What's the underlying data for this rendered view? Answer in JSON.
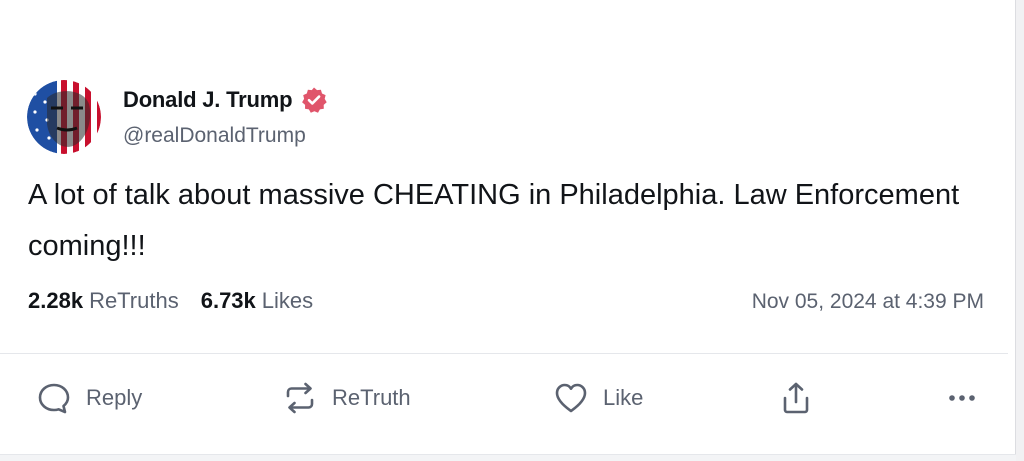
{
  "post": {
    "author": {
      "display_name": "Donald J. Trump",
      "handle": "@realDonaldTrump",
      "verified": true
    },
    "text": "A lot of talk about massive CHEATING in Philadelphia. Law Enforcement coming!!!",
    "stats": {
      "retruths_count": "2.28k",
      "retruths_label": "ReTruths",
      "likes_count": "6.73k",
      "likes_label": "Likes"
    },
    "timestamp": "Nov 05, 2024 at 4:39 PM"
  },
  "actions": {
    "reply_label": "Reply",
    "retruth_label": "ReTruth",
    "like_label": "Like"
  },
  "colors": {
    "verified_badge": "#e0556b",
    "muted_text": "#5b6270",
    "primary_text": "#111418",
    "divider": "#e5e7eb"
  },
  "icons": [
    "verified-badge-icon",
    "reply-icon",
    "retruth-icon",
    "heart-icon",
    "share-icon",
    "more-icon"
  ]
}
